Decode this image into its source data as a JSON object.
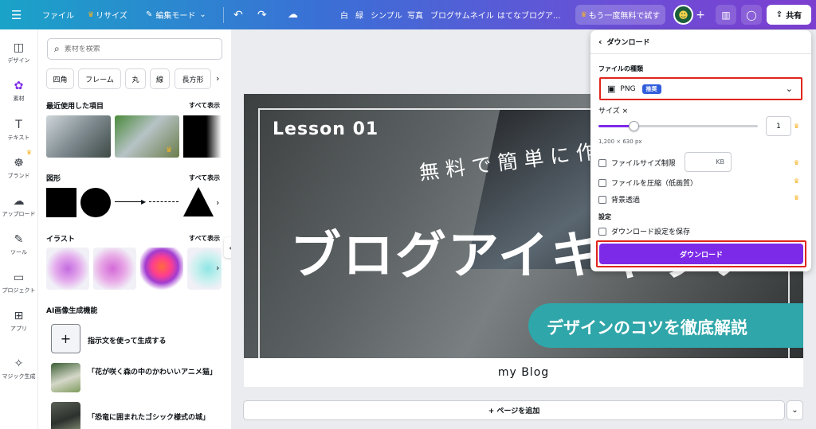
{
  "topbar": {
    "file": "ファイル",
    "resize": "リサイズ",
    "edit_mode": "編集モード",
    "menu_items": [
      "白",
      "緑",
      "シンプル",
      "写真",
      "ブログサムネイル",
      "はてなブログア..."
    ],
    "trial": "もう一度無料で試す",
    "share": "共有"
  },
  "rail": [
    {
      "label": "デザイン",
      "icon": "layout-icon"
    },
    {
      "label": "素材",
      "icon": "elements-icon"
    },
    {
      "label": "テキスト",
      "icon": "text-icon"
    },
    {
      "label": "ブランド",
      "icon": "brand-icon"
    },
    {
      "label": "アップロード",
      "icon": "upload-icon"
    },
    {
      "label": "ツール",
      "icon": "draw-icon"
    },
    {
      "label": "プロジェクト",
      "icon": "folder-icon"
    },
    {
      "label": "アプリ",
      "icon": "apps-icon"
    },
    {
      "label": "マジック生成",
      "icon": "magic-icon"
    }
  ],
  "panel": {
    "search_placeholder": "素材を検索",
    "chips": [
      "四角",
      "フレーム",
      "丸",
      "線",
      "長方形"
    ],
    "recent_title": "最近使用した項目",
    "shapes_title": "図形",
    "illust_title": "イラスト",
    "see_all": "すべて表示",
    "ai_title": "AI画像生成機能",
    "ai_prompt": "指示文を使って生成する",
    "ai_items": [
      "「花が咲く森の中のかわいいアニメ猫」",
      "「恐竜に囲まれたゴシック様式の城」"
    ]
  },
  "canvas": {
    "lesson": "Lesson 01",
    "subtitle": "無料で簡単に作れる",
    "main_title": "ブログアイキャッチ",
    "banner": "デザインのコツを徹底解説",
    "footer": "my Blog",
    "add_page": "+ ページを追加"
  },
  "download": {
    "title": "ダウンロード",
    "file_type_label": "ファイルの種類",
    "file_type": "PNG",
    "badge": "推奨",
    "size_label": "サイズ ×",
    "size_value": "1",
    "size_fraction": 0.22,
    "dimensions": "1,200 × 630 px",
    "limit_label": "ファイルサイズ制限",
    "kb": "KB",
    "compress_label": "ファイルを圧縮（低画質）",
    "transparent_label": "背景透過",
    "settings_label": "設定",
    "save_settings_label": "ダウンロード設定を保存",
    "button": "ダウンロード"
  },
  "colors": {
    "accent": "#7d2ae8",
    "highlight": "#e0251b",
    "teal": "#2fa6a9"
  }
}
